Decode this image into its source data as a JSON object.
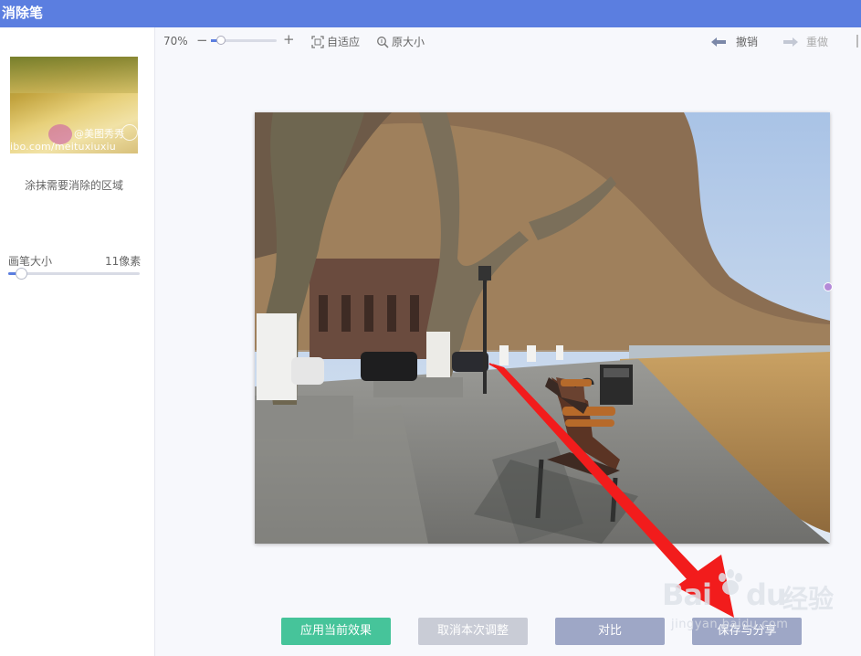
{
  "app": {
    "title": "消除笔"
  },
  "sidebar": {
    "thumbnail": {
      "watermark_name": "@美图秀秀",
      "watermark_url": "ibo.com/meituxiuxiu"
    },
    "hint": "涂抹需要消除的区域",
    "brush": {
      "label": "画笔大小",
      "value_text": "11像素",
      "level_fraction": 0.1
    }
  },
  "toolbar": {
    "zoom_text": "70%",
    "zoom_minus": "−",
    "zoom_plus": "+",
    "zoom_fraction": 0.15,
    "fit_label": "自适应",
    "original_label": "原大小",
    "undo_label": "撤销",
    "redo_label": "重做"
  },
  "actions": {
    "apply": "应用当前效果",
    "cancel": "取消本次调整",
    "compare": "对比",
    "save": "保存与分享"
  },
  "watermark": {
    "brand": "Bai",
    "brand2": "du",
    "cn": "经验",
    "url": "jingyan.baidu.com"
  },
  "colors": {
    "accent": "#5b7ee0",
    "apply": "#46c49a",
    "arrow": "#f21c1c"
  }
}
